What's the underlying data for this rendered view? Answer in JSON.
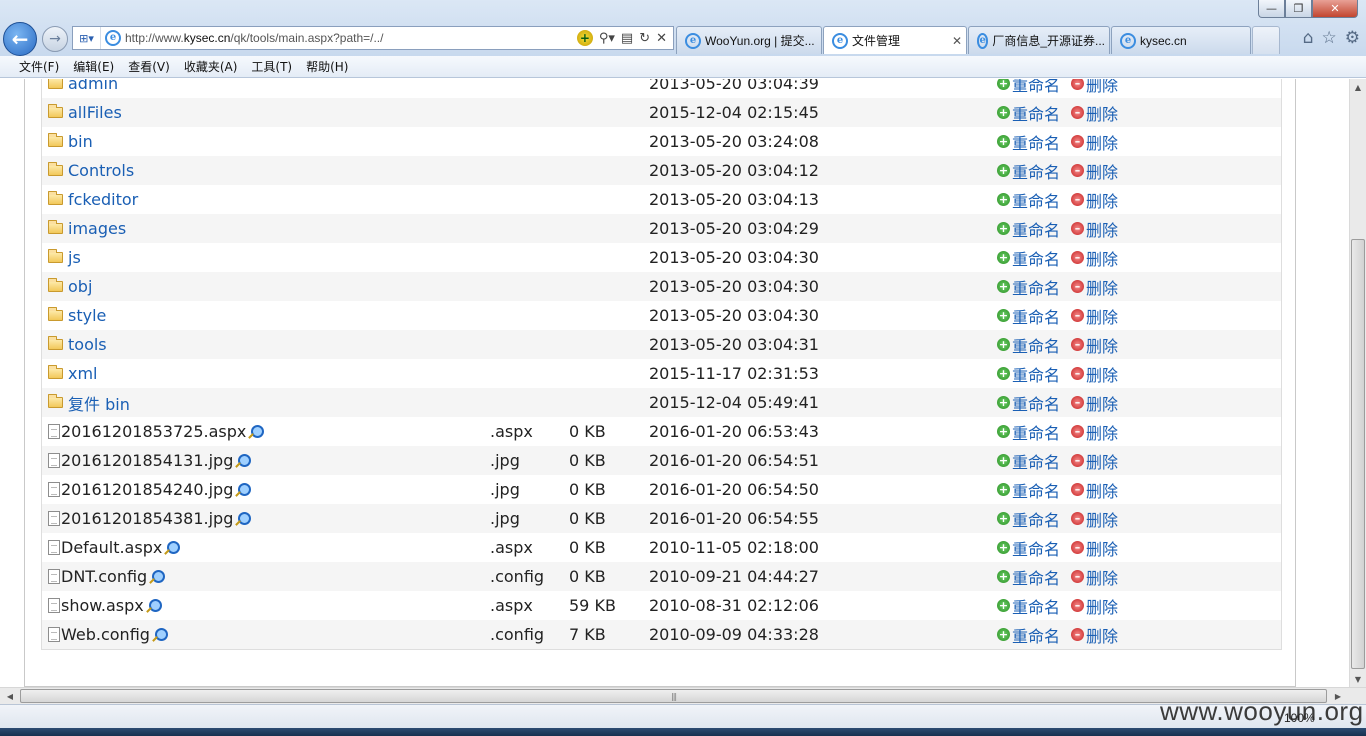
{
  "browser": {
    "window_buttons": {
      "minimize": "—",
      "restore": "❐",
      "close": "✕"
    },
    "address_url_prefix": "http://www.",
    "address_url_domain": "kysec.cn",
    "address_url_suffix": "/qk/tools/main.aspx?path=/../",
    "tabs": [
      {
        "label": "WooYun.org | 提交...",
        "active": false
      },
      {
        "label": "文件管理",
        "active": true,
        "close": "✕"
      },
      {
        "label": "厂商信息_开源证券...",
        "active": false
      },
      {
        "label": "kysec.cn",
        "active": false
      }
    ],
    "menu": [
      "文件(F)",
      "编辑(E)",
      "查看(V)",
      "收藏夹(A)",
      "工具(T)",
      "帮助(H)"
    ]
  },
  "file_list": {
    "actions": {
      "rename": "重命名",
      "delete": "删除"
    },
    "folders": [
      {
        "name": "admin",
        "date": "2013-05-20 03:04:39"
      },
      {
        "name": "allFiles",
        "date": "2015-12-04 02:15:45"
      },
      {
        "name": "bin",
        "date": "2013-05-20 03:24:08"
      },
      {
        "name": "Controls",
        "date": "2013-05-20 03:04:12"
      },
      {
        "name": "fckeditor",
        "date": "2013-05-20 03:04:13"
      },
      {
        "name": "images",
        "date": "2013-05-20 03:04:29"
      },
      {
        "name": "js",
        "date": "2013-05-20 03:04:30"
      },
      {
        "name": "obj",
        "date": "2013-05-20 03:04:30"
      },
      {
        "name": "style",
        "date": "2013-05-20 03:04:30"
      },
      {
        "name": "tools",
        "date": "2013-05-20 03:04:31"
      },
      {
        "name": "xml",
        "date": "2015-11-17 02:31:53"
      },
      {
        "name": "复件 bin",
        "date": "2015-12-04 05:49:41"
      }
    ],
    "files": [
      {
        "name": "20161201853725.aspx",
        "ext": ".aspx",
        "size": "0 KB",
        "date": "2016-01-20 06:53:43"
      },
      {
        "name": "20161201854131.jpg",
        "ext": ".jpg",
        "size": "0 KB",
        "date": "2016-01-20 06:54:51"
      },
      {
        "name": "20161201854240.jpg",
        "ext": ".jpg",
        "size": "0 KB",
        "date": "2016-01-20 06:54:50"
      },
      {
        "name": "20161201854381.jpg",
        "ext": ".jpg",
        "size": "0 KB",
        "date": "2016-01-20 06:54:55"
      },
      {
        "name": "Default.aspx",
        "ext": ".aspx",
        "size": "0 KB",
        "date": "2010-11-05 02:18:00"
      },
      {
        "name": "DNT.config",
        "ext": ".config",
        "size": "0 KB",
        "date": "2010-09-21 04:44:27"
      },
      {
        "name": "show.aspx",
        "ext": ".aspx",
        "size": "59 KB",
        "date": "2010-08-31 02:12:06"
      },
      {
        "name": "Web.config",
        "ext": ".config",
        "size": "7 KB",
        "date": "2010-09-09 04:33:28"
      }
    ]
  },
  "status": {
    "zoom": "100%",
    "watermark": "www.wooyun.org"
  }
}
